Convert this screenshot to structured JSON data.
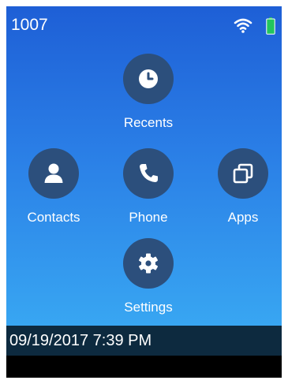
{
  "status_bar": {
    "line_number": "1007",
    "wifi_icon": "wifi-icon",
    "battery_icon": "battery-full-icon",
    "battery_color": "#22c55e"
  },
  "apps": {
    "recents": {
      "label": "Recents",
      "icon": "clock-icon"
    },
    "contacts": {
      "label": "Contacts",
      "icon": "person-icon"
    },
    "phone": {
      "label": "Phone",
      "icon": "phone-handset-icon"
    },
    "apps": {
      "label": "Apps",
      "icon": "stacked-windows-icon"
    },
    "settings": {
      "label": "Settings",
      "icon": "gear-icon"
    }
  },
  "footer": {
    "datetime": "09/19/2017 7:39 PM"
  },
  "colors": {
    "background_top": "#1e5fd6",
    "background_bottom": "#38a6f2",
    "icon_circle": "#2c4f7c",
    "footer_bar": "#0d2a3f"
  }
}
